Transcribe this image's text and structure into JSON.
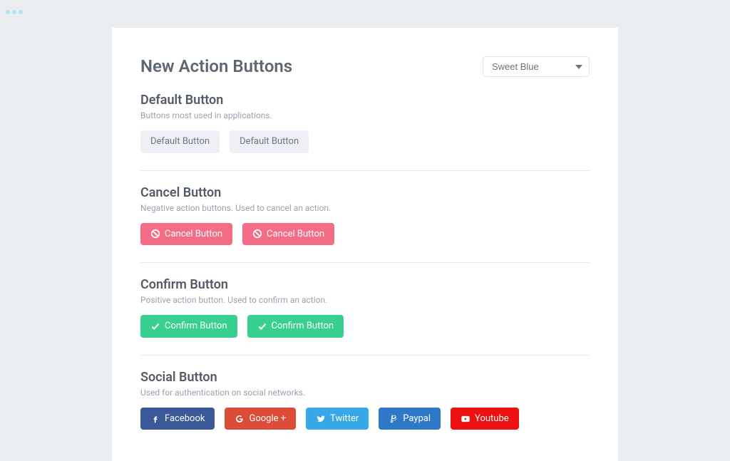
{
  "header": {
    "title": "New Action Buttons",
    "theme_selected": "Sweet Blue"
  },
  "sections": {
    "default": {
      "title": "Default Button",
      "desc": "Buttons most used in applications.",
      "button1": "Default Button",
      "button2": "Default Button"
    },
    "cancel": {
      "title": "Cancel Button",
      "desc": "Negative action buttons. Used to cancel an action.",
      "button1": "Cancel Button",
      "button2": "Cancel Button"
    },
    "confirm": {
      "title": "Confirm Button",
      "desc": "Positive action button. Used to confirm an action.",
      "button1": "Confirm Button",
      "button2": "Confirm Button"
    },
    "social": {
      "title": "Social Button",
      "desc": "Used for authentication on social networks.",
      "facebook": "Facebook",
      "google": "Google +",
      "twitter": "Twitter",
      "paypal": "Paypal",
      "youtube": "Youtube"
    }
  }
}
